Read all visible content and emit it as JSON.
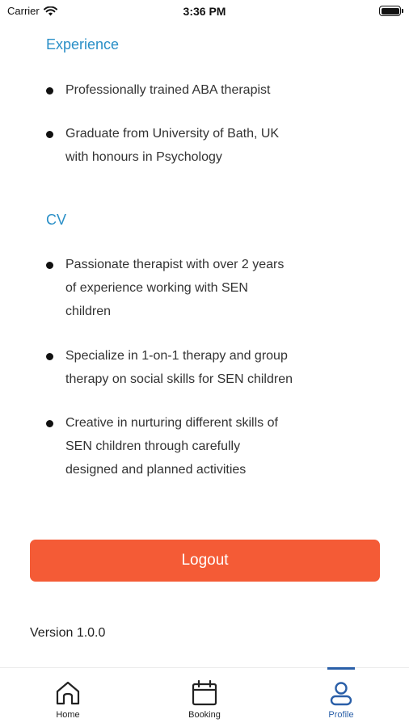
{
  "status_bar": {
    "carrier": "Carrier",
    "time": "3:36 PM"
  },
  "experience": {
    "title": "Experience",
    "items": [
      "Professionally trained ABA therapist",
      "Graduate from University of Bath, UK\nwith honours  in Psychology"
    ]
  },
  "cv": {
    "title": "CV",
    "items": [
      "Passionate therapist with over 2 years\nof experience working with SEN\nchildren",
      "Specialize in 1-on-1 therapy and group\ntherapy on social skills for SEN children",
      "Creative in nurturing different skills of\nSEN children through carefully\ndesigned and planned activities"
    ]
  },
  "logout_label": "Logout",
  "version": "Version 1.0.0",
  "tabs": [
    {
      "label": "Home",
      "icon": "home-icon"
    },
    {
      "label": "Booking",
      "icon": "calendar-icon"
    },
    {
      "label": "Profile",
      "icon": "profile-icon",
      "active": true
    }
  ],
  "colors": {
    "accent": "#f45b36",
    "section_title": "#2a8fc7",
    "active_tab": "#2a5fa8"
  }
}
